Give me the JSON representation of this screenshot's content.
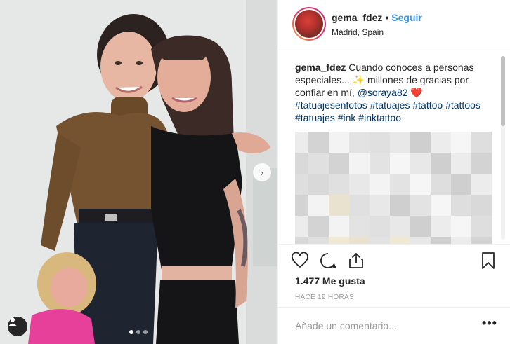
{
  "post": {
    "username": "gema_fdez",
    "separator": "•",
    "follow_label": "Seguir",
    "location": "Madrid, Spain",
    "avatar_icon": "profile-avatar",
    "caption": {
      "username": "gema_fdez",
      "text1": "Cuando conoces a personas especiales...",
      "sparkle": "✨",
      "text2": "millones de gracias por confiar en mí,",
      "mention": "@soraya82",
      "heart": "❤️",
      "hashtags": [
        "#tatuajesenfotos",
        "#tatuajes",
        "#tattoo",
        "#tattoos",
        "#tatuajes",
        "#ink",
        "#inktattoo"
      ]
    },
    "likes": "1.477 Me gusta",
    "time": "HACE 19 HORAS",
    "comment_placeholder": "Añade un comentario...",
    "more_label": "•••",
    "carousel": {
      "pages": 3,
      "active": 0
    },
    "icons": [
      "heart-icon",
      "comment-icon",
      "share-icon",
      "bookmark-icon",
      "next-arrow-icon",
      "user-tag-icon"
    ],
    "colors": {
      "link": "#003569",
      "follow": "#3897f0",
      "text": "#262626",
      "muted": "#999999"
    }
  }
}
